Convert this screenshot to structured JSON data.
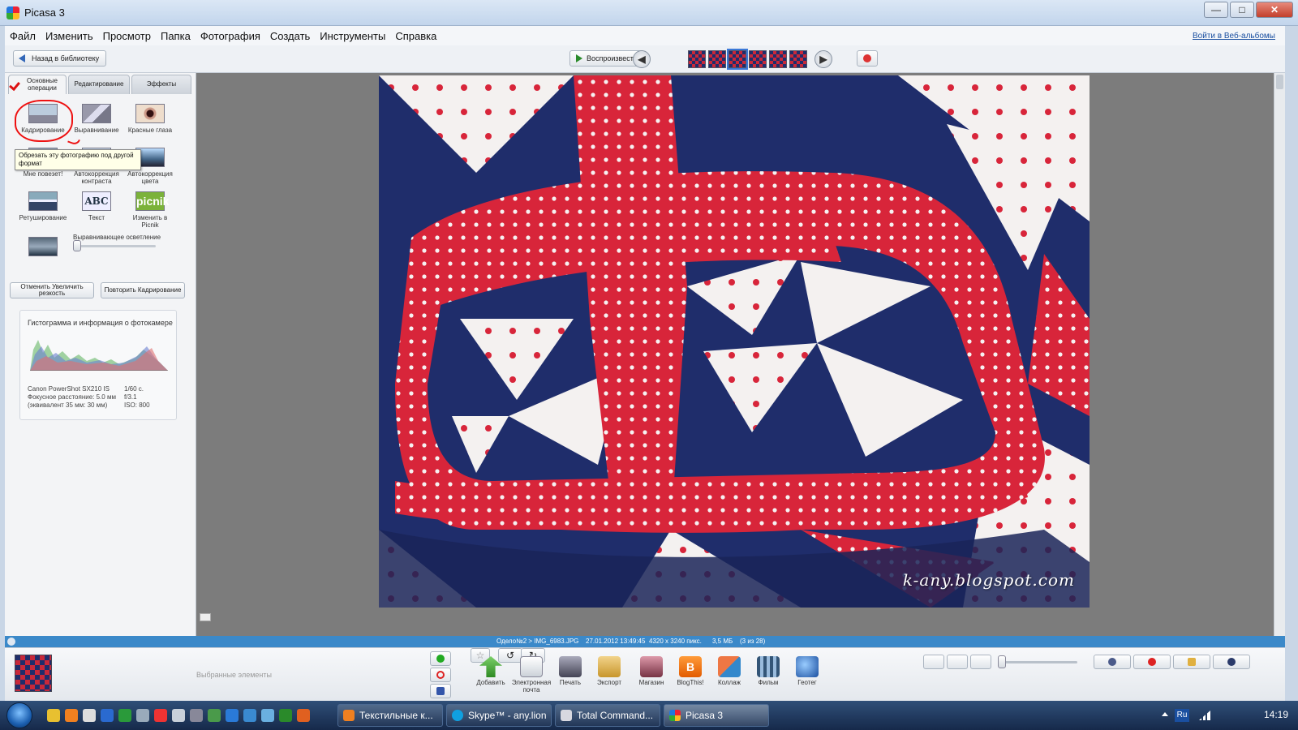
{
  "window": {
    "title": "Picasa 3",
    "minimize": "—",
    "maximize": "□",
    "close": "✕"
  },
  "menu": {
    "items": [
      "Файл",
      "Изменить",
      "Просмотр",
      "Папка",
      "Фотография",
      "Создать",
      "Инструменты",
      "Справка"
    ],
    "login": "Войти в Веб-альбомы"
  },
  "toolbar": {
    "back": "Назад в библиотеку",
    "play": "Воспроизвести",
    "prev": "◀",
    "next": "▶"
  },
  "left": {
    "tabs": [
      "Основные операции",
      "Редактирование",
      "Эффекты"
    ],
    "tools": [
      {
        "label": "Кадрирование",
        "icon": "crop-icon"
      },
      {
        "label": "Выравнивание",
        "icon": "straighten-icon"
      },
      {
        "label": "Красные глаза",
        "icon": "redeye-icon"
      },
      {
        "label": "Мне повезет!",
        "icon": "lucky-icon"
      },
      {
        "label": "Автокоррекция контраста",
        "icon": "auto-contrast-icon"
      },
      {
        "label": "Автокоррекция цвета",
        "icon": "auto-color-icon"
      },
      {
        "label": "Ретуширование",
        "icon": "retouch-icon"
      },
      {
        "label": "Текст",
        "icon": "text-icon",
        "glyph": "ABC"
      },
      {
        "label": "Изменить в Picnik",
        "icon": "picnik-icon",
        "glyph": "picnik"
      }
    ],
    "tooltip": "Обрезать эту фотографию под другой формат",
    "fill_light_label": "Выравнивающее осветление",
    "fill_light_value": 0,
    "undo": "Отменить Увеличить резкость",
    "redo": "Повторить Кадрирование",
    "histogram_title": "Гистограмма и информация о фотокамере",
    "camera": {
      "model": "Canon PowerShot SX210 IS",
      "focal": "Фокусное расстояние: 5.0 мм",
      "equiv": "(эквивалент 35 мм: 30 мм)",
      "shutter": "1/60 с.",
      "aperture": "f/3.1",
      "iso": "ISO: 800"
    }
  },
  "main": {
    "watermark": "k-any.blogspot.com"
  },
  "status": {
    "path": "Одело№2 > IMG_6983.JPG",
    "datetime": "27.01.2012 13:49:45",
    "dims": "4320 x 3240 пикс.",
    "size": "3,5 МБ",
    "index": "(3 из 28)"
  },
  "tray": {
    "selected": "Выбранные элементы",
    "actions": [
      {
        "label": "Добавить",
        "icon": "upload-icon"
      },
      {
        "label": "Электронная почта",
        "icon": "email-icon"
      },
      {
        "label": "Печать",
        "icon": "print-icon"
      },
      {
        "label": "Экспорт",
        "icon": "export-icon"
      },
      {
        "label": "Магазин",
        "icon": "shop-icon"
      },
      {
        "label": "BlogThis!",
        "icon": "blogger-icon",
        "glyph": "B"
      },
      {
        "label": "Коллаж",
        "icon": "collage-icon"
      },
      {
        "label": "Фильм",
        "icon": "movie-icon"
      },
      {
        "label": "Геотег",
        "icon": "geotag-icon"
      }
    ],
    "zoom_value": 0
  },
  "taskbar": {
    "tasks": [
      "Текстильные к...",
      "Skype™ - any.lion",
      "Total Command...",
      "Picasa 3"
    ],
    "lang": "Ru",
    "time": "14:19"
  },
  "colors": {
    "accent": "#3b89c9",
    "polka_red": "#d8253a",
    "navy": "#1f2d6b",
    "annotation_red": "#e11111"
  }
}
